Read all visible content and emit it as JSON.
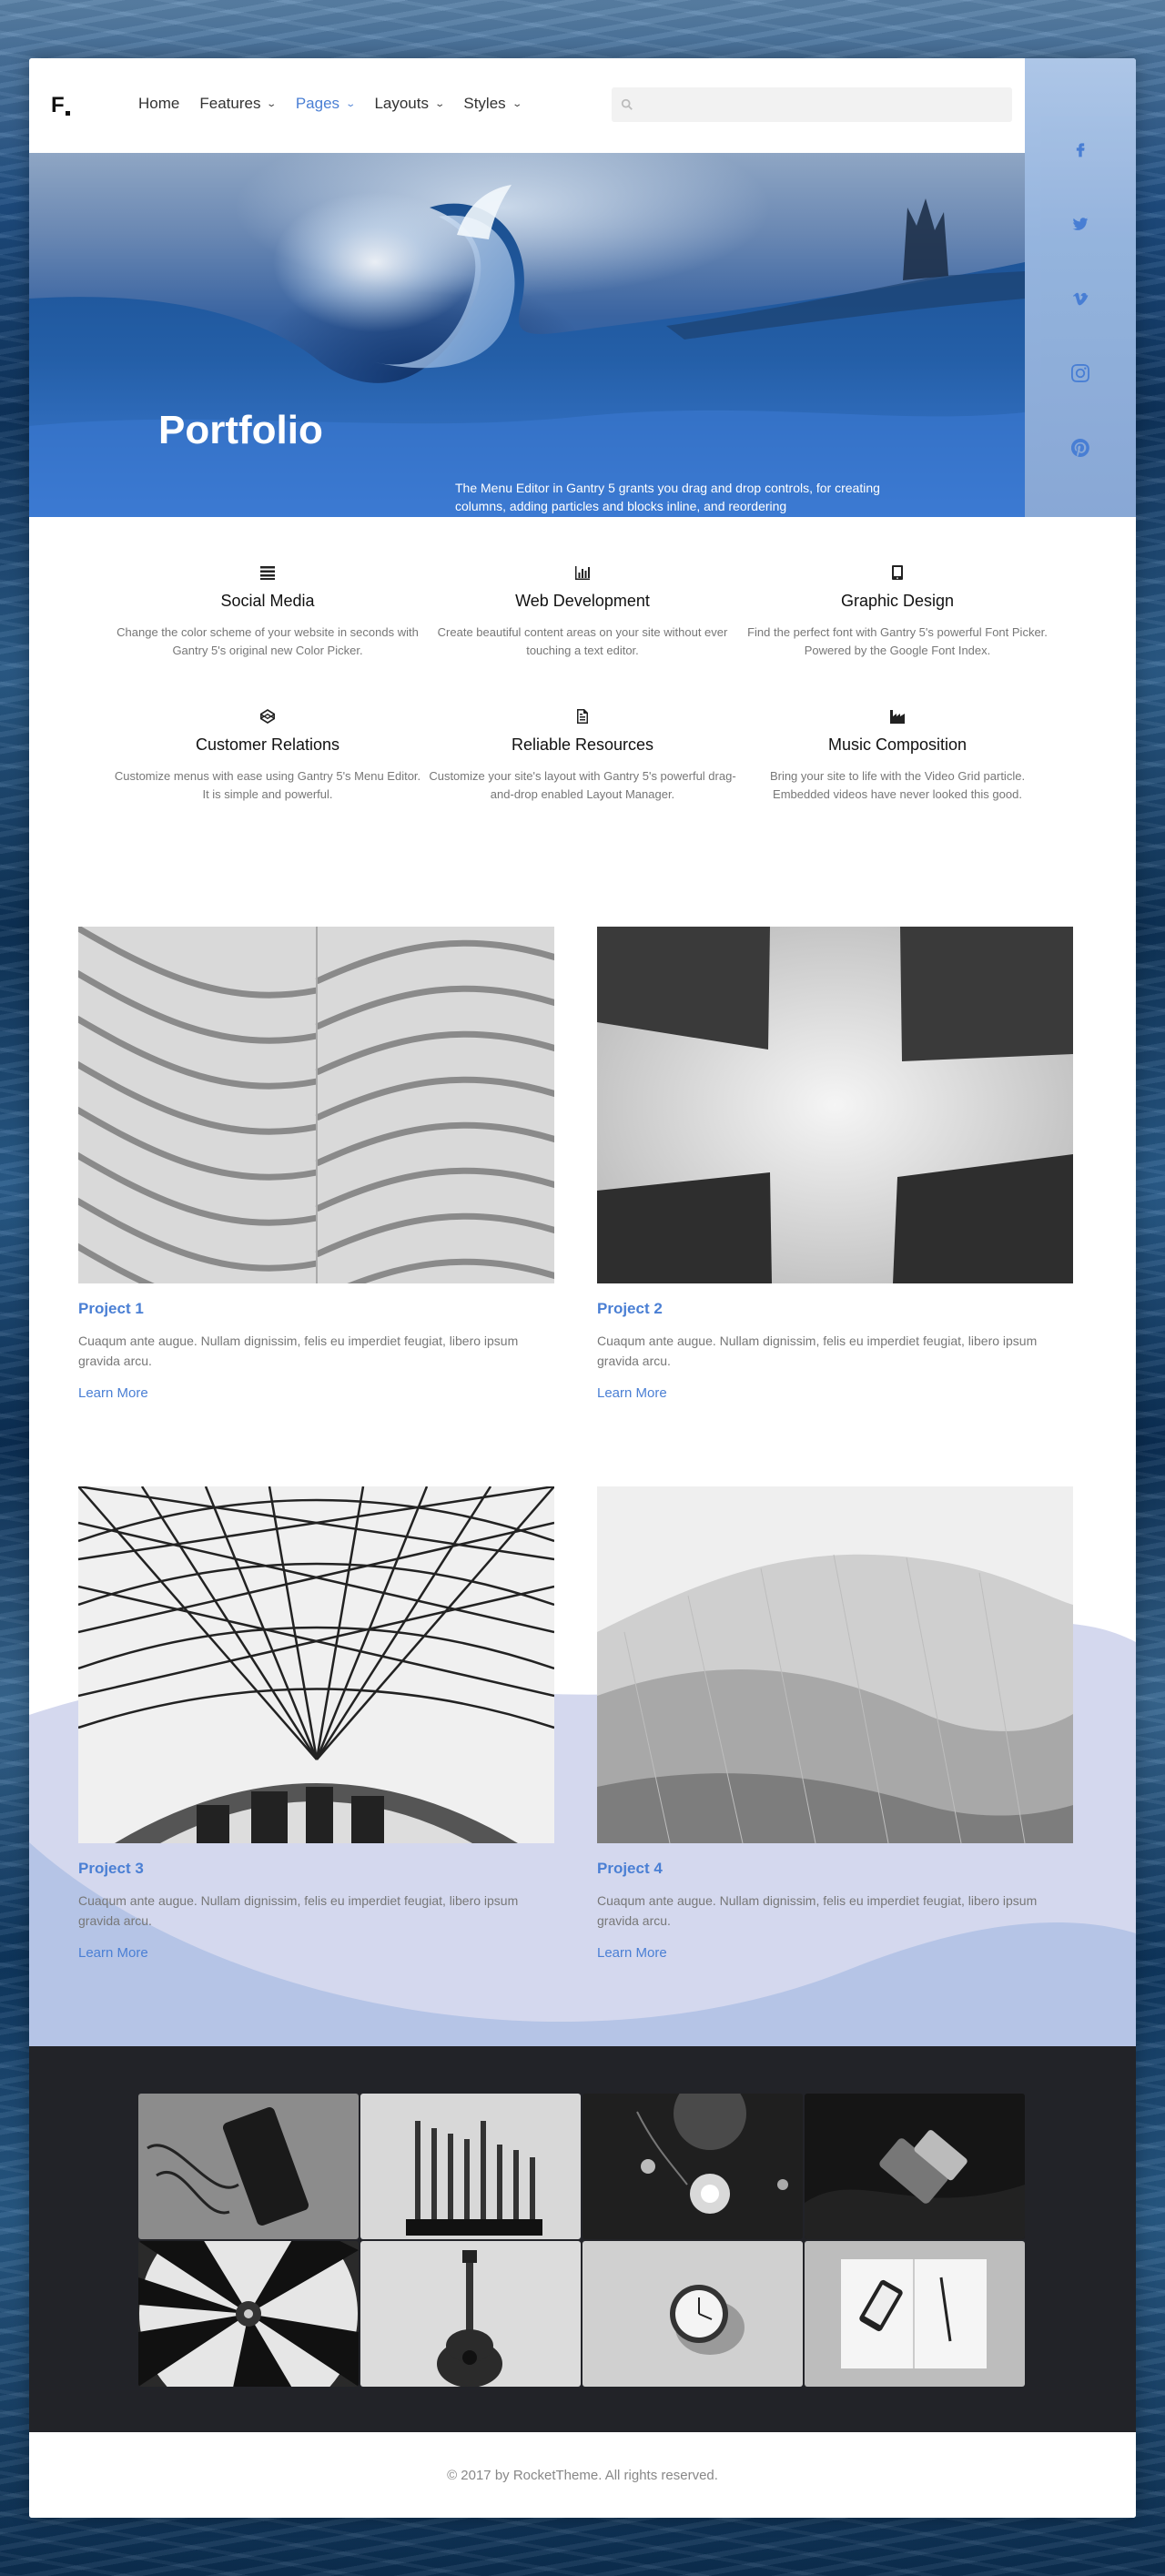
{
  "header": {
    "logo": "F",
    "nav": [
      {
        "label": "Home",
        "dropdown": false,
        "active": false
      },
      {
        "label": "Features",
        "dropdown": true,
        "active": false
      },
      {
        "label": "Pages",
        "dropdown": true,
        "active": true
      },
      {
        "label": "Layouts",
        "dropdown": true,
        "active": false
      },
      {
        "label": "Styles",
        "dropdown": true,
        "active": false
      }
    ],
    "search": {
      "placeholder": "",
      "value": ""
    }
  },
  "social": [
    {
      "icon": "facebook-icon"
    },
    {
      "icon": "twitter-icon"
    },
    {
      "icon": "vimeo-icon"
    },
    {
      "icon": "instagram-icon"
    },
    {
      "icon": "pinterest-icon"
    }
  ],
  "hero": {
    "title": "Portfolio",
    "text": "The Menu Editor in Gantry 5 grants you drag and drop controls, for creating columns, adding particles and blocks inline, and reordering"
  },
  "features": [
    {
      "icon": "list-icon",
      "title": "Social Media",
      "text": "Change the color scheme of your website in seconds with Gantry 5's original new Color Picker."
    },
    {
      "icon": "bar-chart-icon",
      "title": "Web Development",
      "text": "Create beautiful content areas on your site without ever touching a text editor."
    },
    {
      "icon": "tablet-icon",
      "title": "Graphic Design",
      "text": "Find the perfect font with Gantry 5's powerful Font Picker. Powered by the Google Font Index."
    },
    {
      "icon": "codepen-icon",
      "title": "Customer Relations",
      "text": "Customize menus with ease using Gantry 5's Menu Editor. It is simple and powerful."
    },
    {
      "icon": "file-icon",
      "title": "Reliable Resources",
      "text": "Customize your site's layout with Gantry 5's powerful drag-and-drop enabled Layout Manager."
    },
    {
      "icon": "industry-icon",
      "title": "Music Composition",
      "text": "Bring your site to life with the Video Grid particle. Embedded videos have never looked this good."
    }
  ],
  "projects": [
    {
      "title": "Project 1",
      "text": "Cuaqum ante augue. Nullam dignissim, felis eu imperdiet feugiat, libero ipsum gravida arcu.",
      "link": "Learn More"
    },
    {
      "title": "Project 2",
      "text": "Cuaqum ante augue. Nullam dignissim, felis eu imperdiet feugiat, libero ipsum gravida arcu.",
      "link": "Learn More"
    },
    {
      "title": "Project 3",
      "text": "Cuaqum ante augue. Nullam dignissim, felis eu imperdiet feugiat, libero ipsum gravida arcu.",
      "link": "Learn More"
    },
    {
      "title": "Project 4",
      "text": "Cuaqum ante augue. Nullam dignissim, felis eu imperdiet feugiat, libero ipsum gravida arcu.",
      "link": "Learn More"
    }
  ],
  "footer": {
    "copyright": "© 2017 by RocketTheme. All rights reserved."
  },
  "colors": {
    "accent": "#4a7fd4",
    "dark_section": "#222328",
    "wave_light": "#d4d8ee",
    "wave_dark": "#b5c4e6"
  }
}
